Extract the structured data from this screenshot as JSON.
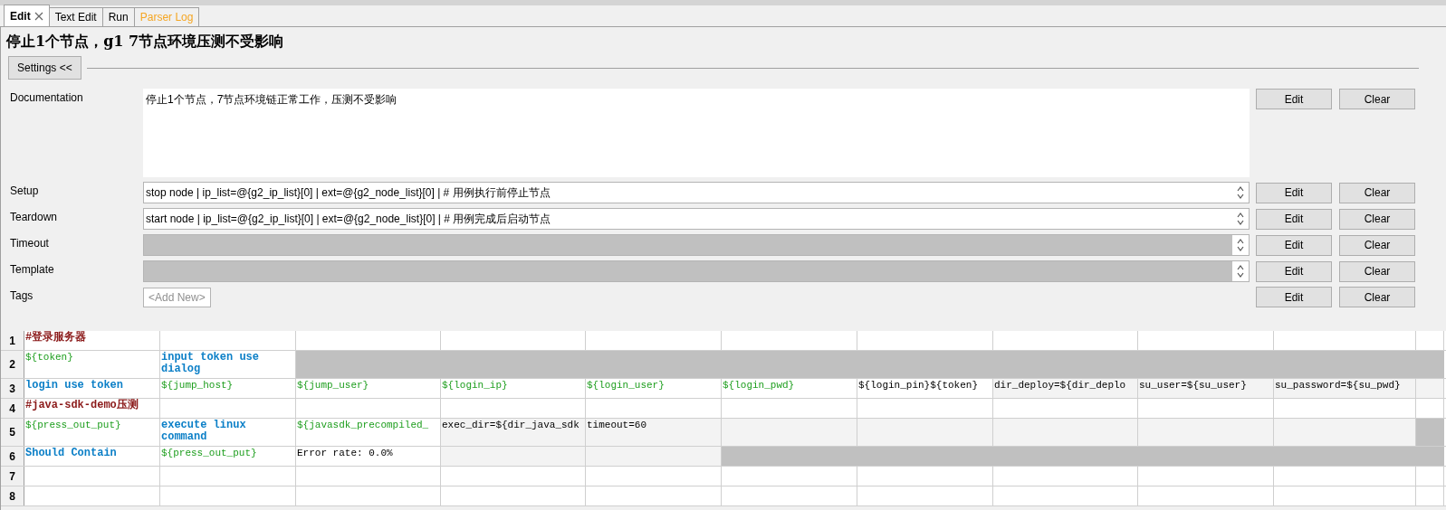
{
  "tabs": [
    {
      "label": "Edit",
      "selected": true,
      "closable": true,
      "color": "#000000"
    },
    {
      "label": "Text Edit",
      "selected": false,
      "closable": false,
      "color": "#000000"
    },
    {
      "label": "Run",
      "selected": false,
      "closable": false,
      "color": "#000000"
    },
    {
      "label": "Parser Log",
      "selected": false,
      "closable": false,
      "color": "#f5a623"
    }
  ],
  "title": "停止1个节点，g1 7节点环境压测不受影响",
  "settings_button": "Settings <<",
  "settings": [
    {
      "kind": "documentation",
      "label": "Documentation",
      "value": "停止1个节点，7节点环境链正常工作，压测不受影响",
      "edit": "Edit",
      "clear": "Clear"
    },
    {
      "kind": "field",
      "label": "Setup",
      "value": "stop node | ip_list=@{g2_ip_list}[0] | ext=@{g2_node_list}[0] | # 用例执行前停止节点",
      "disabled": false,
      "edit": "Edit",
      "clear": "Clear"
    },
    {
      "kind": "field",
      "label": "Teardown",
      "value": "start node | ip_list=@{g2_ip_list}[0] | ext=@{g2_node_list}[0] | # 用例完成后启动节点",
      "disabled": false,
      "edit": "Edit",
      "clear": "Clear"
    },
    {
      "kind": "field",
      "label": "Timeout",
      "disabled": true,
      "edit": "Edit",
      "clear": "Clear"
    },
    {
      "kind": "field",
      "label": "Template",
      "disabled": true,
      "edit": "Edit",
      "clear": "Clear"
    },
    {
      "kind": "tags",
      "label": "Tags",
      "add": "<Add New>",
      "edit": "Edit",
      "clear": "Clear"
    }
  ],
  "grid": {
    "rows": [
      {
        "number": "1",
        "cells": [
          {
            "text": "#登录服务器",
            "kind": "comment",
            "shaded": false
          }
        ]
      },
      {
        "number": "2",
        "cells": [
          {
            "text": "${token}",
            "kind": "variable",
            "shaded": false
          },
          {
            "text": "input token use dialog",
            "kind": "keyword",
            "shaded": false
          },
          {
            "kind": "unavailable"
          },
          {
            "kind": "unavailable"
          },
          {
            "kind": "unavailable"
          },
          {
            "kind": "unavailable"
          },
          {
            "kind": "unavailable"
          },
          {
            "kind": "unavailable"
          },
          {
            "kind": "unavailable"
          },
          {
            "kind": "unavailable"
          },
          {
            "kind": "unavailable"
          }
        ]
      },
      {
        "number": "3",
        "cells": [
          {
            "text": "login use token",
            "kind": "keyword",
            "shaded": false
          },
          {
            "text": "${jump_host}",
            "kind": "variable",
            "shaded": false
          },
          {
            "text": "${jump_user}",
            "kind": "variable",
            "shaded": false
          },
          {
            "text": "${login_ip}",
            "kind": "variable",
            "shaded": false
          },
          {
            "text": "${login_user}",
            "kind": "variable",
            "shaded": false
          },
          {
            "text": "${login_pwd}",
            "kind": "variable",
            "shaded": false
          },
          {
            "text": "${login_pin}${token}",
            "kind": "text",
            "shaded": false
          },
          {
            "text": "dir_deploy=${dir_deplo",
            "kind": "text",
            "shaded": true
          },
          {
            "text": "su_user=${su_user}",
            "kind": "text",
            "shaded": true
          },
          {
            "text": "su_password=${su_pwd}",
            "kind": "text",
            "shaded": true
          },
          {
            "kind": "blank",
            "shaded": true
          }
        ]
      },
      {
        "number": "4",
        "cells": [
          {
            "text": "#java-sdk-demo压测",
            "kind": "comment",
            "shaded": false
          }
        ]
      },
      {
        "number": "5",
        "cells": [
          {
            "text": "${press_out_put}",
            "kind": "variable",
            "shaded": false
          },
          {
            "text": "execute linux command",
            "kind": "keyword",
            "shaded": false
          },
          {
            "text": "${javasdk_precompiled_",
            "kind": "variable",
            "shaded": false
          },
          {
            "text": "exec_dir=${dir_java_sdk",
            "kind": "text",
            "shaded": true
          },
          {
            "text": "timeout=60",
            "kind": "text",
            "shaded": true
          },
          {
            "kind": "blank",
            "shaded": true
          },
          {
            "kind": "blank",
            "shaded": true
          },
          {
            "kind": "blank",
            "shaded": true
          },
          {
            "kind": "blank",
            "shaded": true
          },
          {
            "kind": "blank",
            "shaded": true
          },
          {
            "kind": "unavailable"
          }
        ]
      },
      {
        "number": "6",
        "cells": [
          {
            "text": "Should Contain",
            "kind": "keyword",
            "shaded": false
          },
          {
            "text": "${press_out_put}",
            "kind": "variable",
            "shaded": false
          },
          {
            "text": "Error rate: 0.0%",
            "kind": "text",
            "shaded": false
          },
          {
            "kind": "blank",
            "shaded": true
          },
          {
            "kind": "blank",
            "shaded": true
          },
          {
            "kind": "unavailable"
          },
          {
            "kind": "unavailable"
          },
          {
            "kind": "unavailable"
          },
          {
            "kind": "unavailable"
          },
          {
            "kind": "unavailable"
          },
          {
            "kind": "unavailable"
          }
        ]
      },
      {
        "number": "7",
        "cells": []
      },
      {
        "number": "8",
        "cells": []
      }
    ]
  }
}
